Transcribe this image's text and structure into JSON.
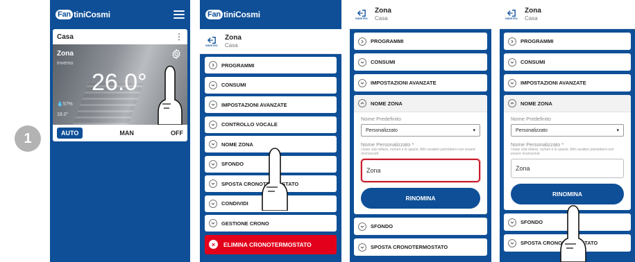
{
  "step_number": "1",
  "colors": {
    "brand": "#0e4f97",
    "danger": "#e3001b",
    "highlight": "#c81e2d"
  },
  "brand": {
    "logo_badge": "Fan",
    "logo_text": "tiniCosmi"
  },
  "screen1": {
    "home_name": "Casa",
    "zone_name": "Zona",
    "zone_mode": "Inverno",
    "temperature": "26.0°",
    "humidity": "57%",
    "setpoint": "18.0°",
    "modes": [
      "AUTO",
      "MAN",
      "OFF"
    ]
  },
  "zone_header": {
    "back_label": "INDIETRO",
    "title": "Zona",
    "subtitle": "Casa"
  },
  "screen2": {
    "menu_items": [
      "PROGRAMMI",
      "CONSUMI",
      "IMPOSTAZIONI AVANZATE",
      "CONTROLLO VOCALE",
      "NOME ZONA",
      "SFONDO",
      "SPOSTA CRONOTERMOSTATO",
      "CONDIVIDI",
      "GESTIONE CRONO"
    ],
    "delete_label": "ELIMINA CRONOTERMOSTATO"
  },
  "screen3": {
    "items_before": [
      "PROGRAMMI",
      "CONSUMI",
      "IMPOSTAZIONI AVANZATE"
    ],
    "open_item": "NOME ZONA",
    "default_name_label": "Nome Predefinito",
    "default_name_value": "Personalizzato",
    "custom_name_label": "Nome Personalizzato *",
    "custom_name_hint": "Usare solo lettere, numeri e lo spazio. Altri caratteri potrebbero non essere riconosciuti.",
    "custom_name_value": "Zona",
    "rename_label": "RINOMINA",
    "items_after": [
      "SFONDO",
      "SPOSTA CRONOTERMOSTATO"
    ]
  }
}
